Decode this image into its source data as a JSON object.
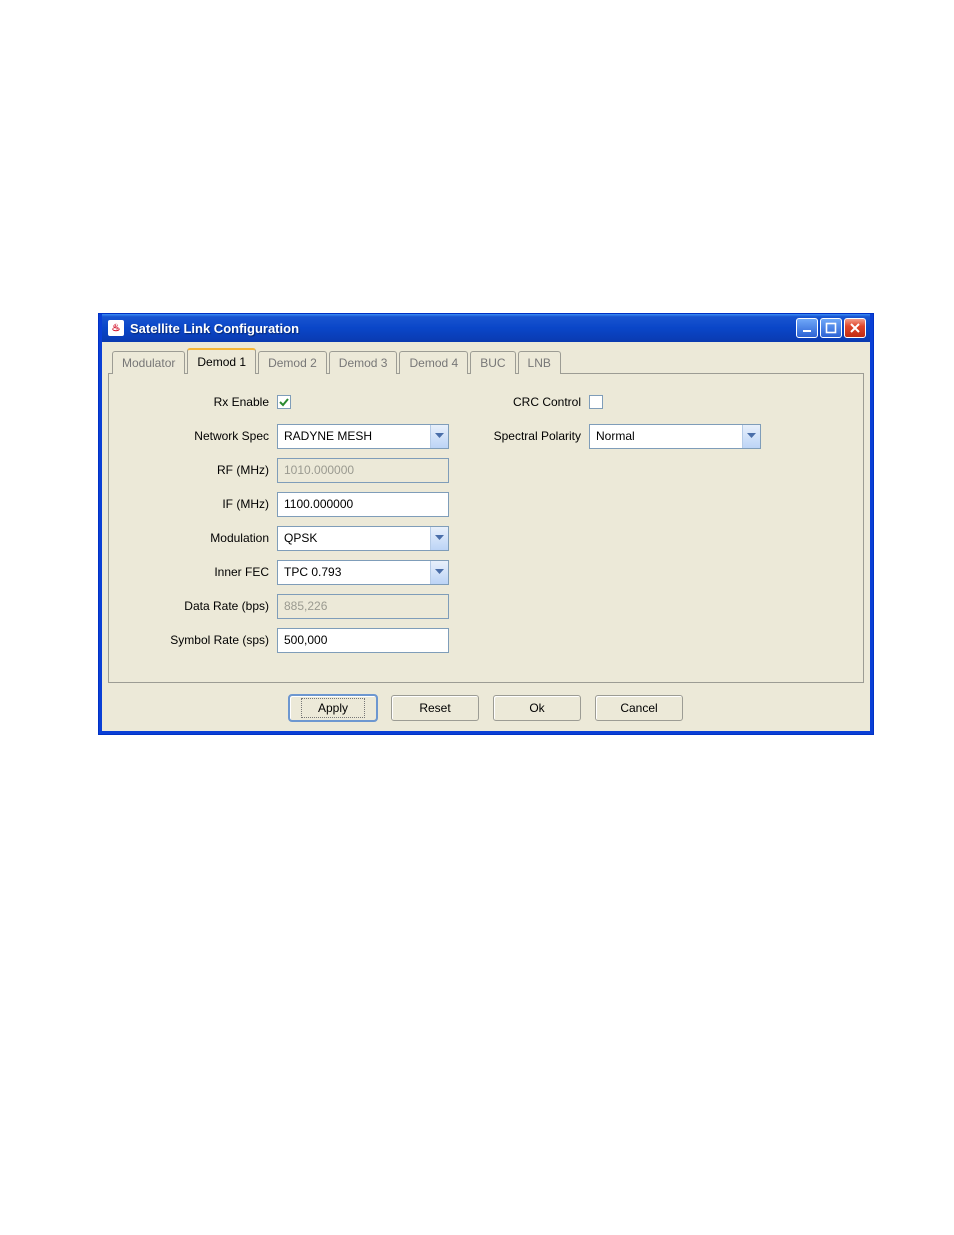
{
  "window": {
    "title": "Satellite Link Configuration"
  },
  "tabs": [
    {
      "label": "Modulator"
    },
    {
      "label": "Demod 1"
    },
    {
      "label": "Demod 2"
    },
    {
      "label": "Demod 3"
    },
    {
      "label": "Demod 4"
    },
    {
      "label": "BUC"
    },
    {
      "label": "LNB"
    }
  ],
  "left": {
    "rx_enable_label": "Rx Enable",
    "network_spec_label": "Network Spec",
    "network_spec_value": "RADYNE MESH",
    "rf_label": "RF (MHz)",
    "rf_value": "1010.000000",
    "if_label": "IF (MHz)",
    "if_value": "1100.000000",
    "modulation_label": "Modulation",
    "modulation_value": "QPSK",
    "inner_fec_label": "Inner FEC",
    "inner_fec_value": "TPC 0.793",
    "data_rate_label": "Data Rate (bps)",
    "data_rate_value": "885,226",
    "symbol_rate_label": "Symbol Rate (sps)",
    "symbol_rate_value": "500,000"
  },
  "right": {
    "crc_label": "CRC Control",
    "spectral_label": "Spectral Polarity",
    "spectral_value": "Normal"
  },
  "buttons": {
    "apply": "Apply",
    "reset": "Reset",
    "ok": "Ok",
    "cancel": "Cancel"
  }
}
